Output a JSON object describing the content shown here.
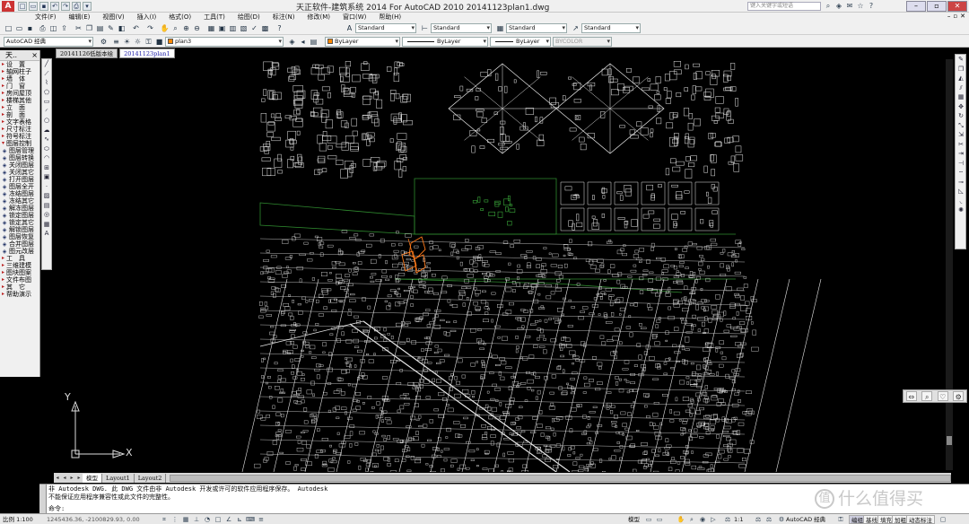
{
  "titlebar": {
    "title": "天正软件-建筑系统 2014  For AutoCAD 2010    20141123plan1.dwg",
    "search_placeholder": "键入关键字或短语",
    "window_controls": [
      "minimize",
      "restore",
      "close"
    ]
  },
  "menu": [
    "文件(F)",
    "编辑(E)",
    "视图(V)",
    "插入(I)",
    "格式(O)",
    "工具(T)",
    "绘图(D)",
    "标注(N)",
    "修改(M)",
    "窗口(W)",
    "帮助(H)"
  ],
  "toolbar": {
    "text_style": "Standard",
    "dim_style": "Standard",
    "table_style": "Standard",
    "multileader_style": "Standard",
    "workspace": "AutoCAD 经典",
    "layer": "plan3",
    "color": "ByLayer",
    "linetype": "ByLayer",
    "lineweight": "ByLayer",
    "plotstyle": "BYCOLOR",
    "color_hex": "#ff8800"
  },
  "doc_tabs": [
    "20141126低版本绘",
    "20141123plan1"
  ],
  "tarch_panel": {
    "title": "天..",
    "items": [
      {
        "label": "设　置",
        "type": "cat"
      },
      {
        "label": "轴网柱子",
        "type": "cat"
      },
      {
        "label": "墙　体",
        "type": "cat"
      },
      {
        "label": "门　窗",
        "type": "cat"
      },
      {
        "label": "房间屋顶",
        "type": "cat"
      },
      {
        "label": "楼梯其他",
        "type": "cat"
      },
      {
        "label": "立　面",
        "type": "cat"
      },
      {
        "label": "剖　面",
        "type": "cat"
      },
      {
        "label": "文字表格",
        "type": "cat"
      },
      {
        "label": "尺寸标注",
        "type": "cat"
      },
      {
        "label": "符号标注",
        "type": "cat"
      },
      {
        "label": "图层控制",
        "type": "open"
      },
      {
        "label": "图层管理",
        "type": "tool"
      },
      {
        "label": "图层转换",
        "type": "tool"
      },
      {
        "label": "关闭图层",
        "type": "tool"
      },
      {
        "label": "关闭其它",
        "type": "tool"
      },
      {
        "label": "打开图层",
        "type": "tool"
      },
      {
        "label": "图层全开",
        "type": "tool"
      },
      {
        "label": "冻结图层",
        "type": "tool"
      },
      {
        "label": "冻结其它",
        "type": "tool"
      },
      {
        "label": "解冻图层",
        "type": "tool"
      },
      {
        "label": "锁定图层",
        "type": "tool"
      },
      {
        "label": "锁定其它",
        "type": "tool"
      },
      {
        "label": "解锁图层",
        "type": "tool"
      },
      {
        "label": "图层恢复",
        "type": "tool"
      },
      {
        "label": "合并图层",
        "type": "tool"
      },
      {
        "label": "图元改层",
        "type": "tool"
      },
      {
        "label": "工　具",
        "type": "cat"
      },
      {
        "label": "三维建模",
        "type": "cat"
      },
      {
        "label": "图块图案",
        "type": "cat"
      },
      {
        "label": "文件布图",
        "type": "cat"
      },
      {
        "label": "其　它",
        "type": "cat"
      },
      {
        "label": "帮助演示",
        "type": "cat"
      }
    ]
  },
  "draw_tools": [
    "line-icon",
    "construction-line-icon",
    "polyline-icon",
    "polygon-icon",
    "rectangle-icon",
    "arc-icon",
    "circle-icon",
    "revision-cloud-icon",
    "spline-icon",
    "ellipse-icon",
    "ellipse-arc-icon",
    "insert-block-icon",
    "make-block-icon",
    "point-icon",
    "hatch-icon",
    "gradient-icon",
    "region-icon",
    "table-icon",
    "mtext-icon"
  ],
  "modify_tools": [
    "erase-icon",
    "copy-icon",
    "mirror-icon",
    "offset-icon",
    "array-icon",
    "move-icon",
    "rotate-icon",
    "scale-icon",
    "stretch-icon",
    "trim-icon",
    "extend-icon",
    "break-at-point-icon",
    "break-icon",
    "join-icon",
    "chamfer-icon",
    "fillet-icon",
    "explode-icon"
  ],
  "ucs": {
    "x_label": "X",
    "y_label": "Y"
  },
  "layout_tabs": [
    "模型",
    "Layout1",
    "Layout2"
  ],
  "command": {
    "line1": "非 Autodesk DWG.  此 DWG 文件由非 Autodesk 开发或许可的软件应用程序保存。  Autodesk",
    "line2": "不能保证应用程序兼容性或此文件的完整性。",
    "prompt": "命令:"
  },
  "watermark": {
    "badge": "值",
    "text": "什么值得买"
  },
  "statusbar": {
    "scale": "比例 1:100",
    "coords": "1245436.36, -2100829.93, 0.00",
    "model": "模型",
    "annotation_scale": "1:1",
    "workspace": "AutoCAD 经典",
    "tarch_buttons": [
      "编组",
      "基线",
      "填充",
      "加粗",
      "动态标注"
    ]
  },
  "colors": {
    "canvas_bg": "#000000",
    "linework": "#e6e6e6",
    "green_layer": "#2f8a2f",
    "orange_layer": "#ff7a1a"
  }
}
